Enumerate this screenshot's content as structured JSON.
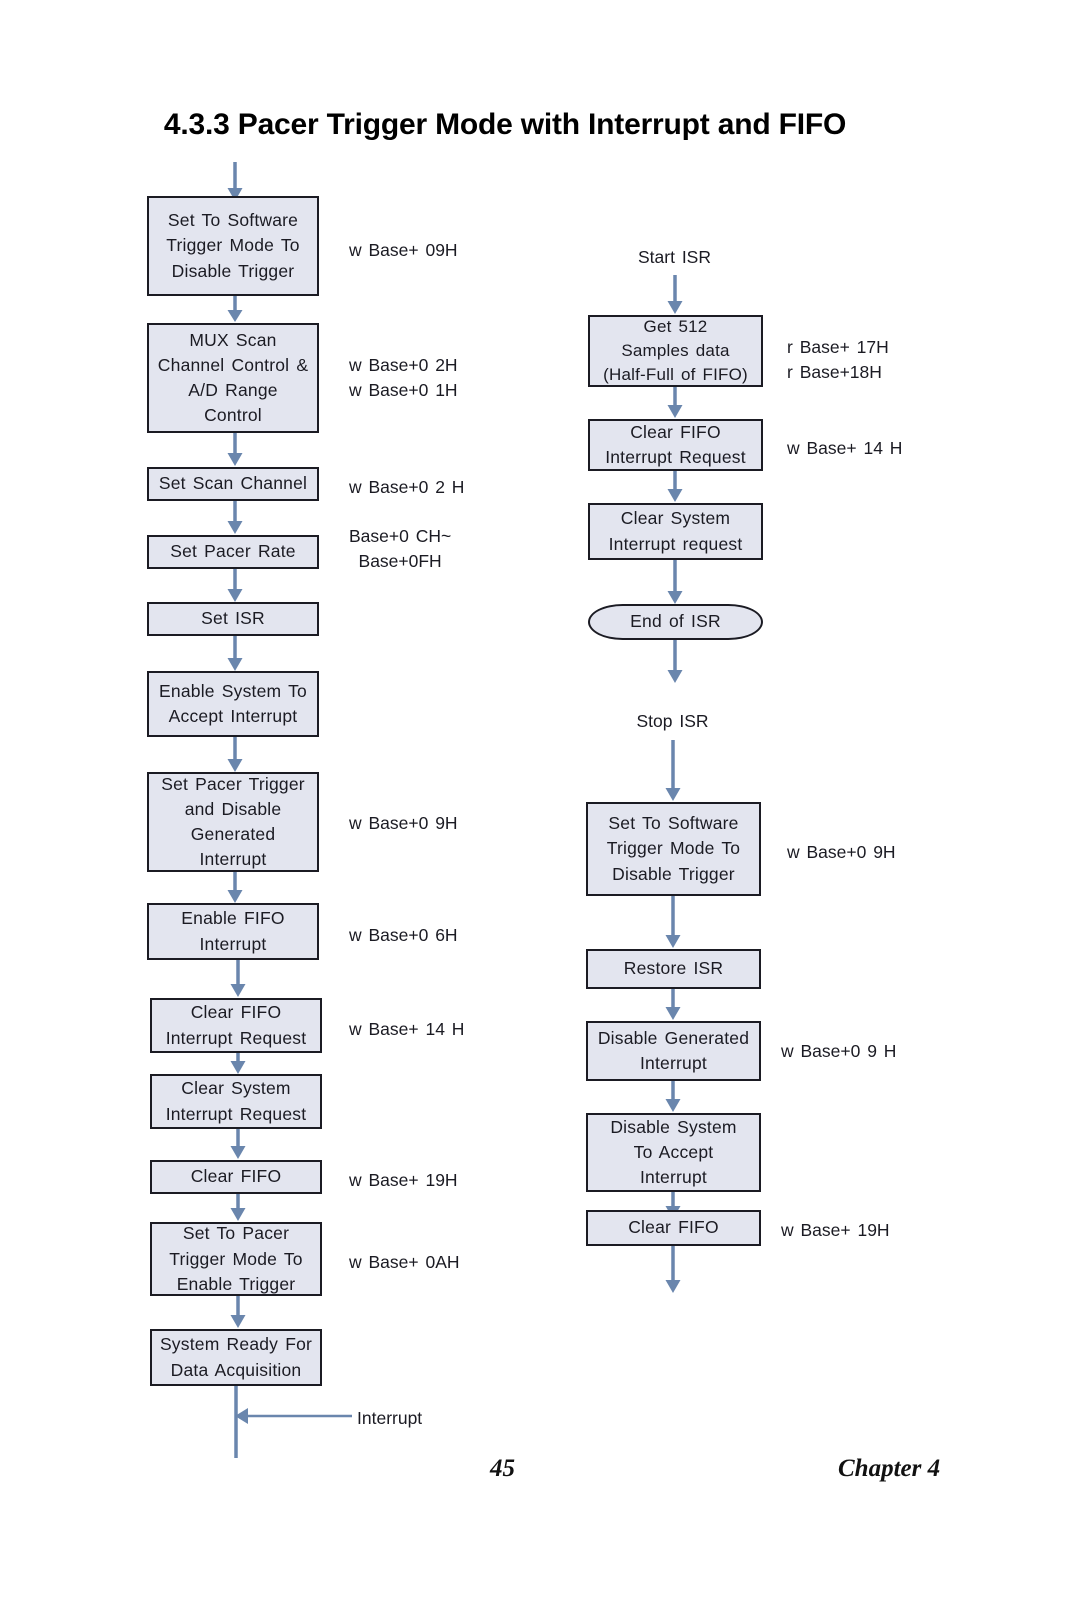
{
  "title": "4.3.3 Pacer Trigger Mode with Interrupt and FIFO",
  "colors": {
    "node_fill": "#e3e5ef",
    "node_border": "#1b1b23",
    "arrow": "#6a86ad",
    "text": "#1b1b23"
  },
  "left_flow": {
    "nodes": [
      {
        "id": "set-software-trigger-disable",
        "lines": [
          "Set To Software",
          "Trigger Mode To",
          "Disable Trigger"
        ],
        "note": [
          "w Base+ 09H"
        ]
      },
      {
        "id": "mux-scan-channel-control",
        "lines": [
          "MUX Scan",
          "Channel Control &",
          "A/D Range",
          "Control"
        ],
        "note": [
          "w Base+0 2H",
          "w Base+0 1H"
        ]
      },
      {
        "id": "set-scan-channel",
        "lines": [
          "Set Scan Channel"
        ],
        "note": [
          "w Base+0 2 H"
        ]
      },
      {
        "id": "set-pacer-rate",
        "lines": [
          "Set Pacer Rate"
        ],
        "note": [
          "Base+0 CH~",
          "Base+0FH"
        ]
      },
      {
        "id": "set-isr",
        "lines": [
          "Set ISR"
        ],
        "note": []
      },
      {
        "id": "enable-system-accept-interrupt",
        "lines": [
          "Enable System To",
          "Accept Interrupt"
        ],
        "note": []
      },
      {
        "id": "set-pacer-trigger-disable-generated-interrupt",
        "lines": [
          "Set Pacer Trigger",
          "and Disable",
          "Generated",
          "Interrupt"
        ],
        "note": [
          "w Base+0 9H"
        ]
      },
      {
        "id": "enable-fifo-interrupt",
        "lines": [
          "Enable FIFO",
          "Interrupt"
        ],
        "note": [
          "w Base+0 6H"
        ]
      },
      {
        "id": "clear-fifo-interrupt-request",
        "lines": [
          "Clear FIFO",
          "Interrupt Request"
        ],
        "note": [
          "w Base+ 14 H"
        ]
      },
      {
        "id": "clear-system-interrupt-request",
        "lines": [
          "Clear System",
          "Interrupt Request"
        ],
        "note": []
      },
      {
        "id": "clear-fifo",
        "lines": [
          "Clear FIFO"
        ],
        "note": [
          "w Base+ 19H"
        ]
      },
      {
        "id": "set-pacer-trigger-enable",
        "lines": [
          "Set To Pacer",
          "Trigger Mode To",
          "Enable Trigger"
        ],
        "note": [
          "w Base+ 0AH"
        ]
      },
      {
        "id": "system-ready-data-acquisition",
        "lines": [
          "System Ready For",
          "Data Acquisition"
        ],
        "note": []
      }
    ],
    "interrupt_label": "Interrupt"
  },
  "right_flow_isr": {
    "start_label": "Start ISR",
    "nodes": [
      {
        "id": "get-512-samples",
        "lines": [
          "Get 512",
          "Samples data",
          "(Half-Full of FIFO)"
        ],
        "note": [
          "r Base+ 17H",
          "r Base+18H"
        ]
      },
      {
        "id": "clear-fifo-interrupt-request-isr",
        "lines": [
          "Clear FIFO",
          "Interrupt Request"
        ],
        "note": [
          "w Base+ 14 H"
        ]
      },
      {
        "id": "clear-system-interrupt-request-isr",
        "lines": [
          "Clear System",
          "Interrupt request"
        ],
        "note": []
      },
      {
        "id": "end-of-isr",
        "lines": [
          "End of ISR"
        ],
        "note": [],
        "shape": "terminator"
      }
    ]
  },
  "right_flow_stop": {
    "start_label": "Stop ISR",
    "nodes": [
      {
        "id": "set-software-trigger-disable-stop",
        "lines": [
          "Set To Software",
          "Trigger Mode To",
          "Disable Trigger"
        ],
        "note": [
          "w Base+0 9H"
        ]
      },
      {
        "id": "restore-isr",
        "lines": [
          "Restore ISR"
        ],
        "note": []
      },
      {
        "id": "disable-generated-interrupt",
        "lines": [
          "Disable Generated",
          "Interrupt"
        ],
        "note": [
          "w Base+0 9 H"
        ]
      },
      {
        "id": "disable-system-accept-interrupt",
        "lines": [
          "Disable System",
          "To Accept",
          "Interrupt"
        ],
        "note": []
      },
      {
        "id": "clear-fifo-stop",
        "lines": [
          "Clear FIFO"
        ],
        "note": [
          "w Base+ 19H"
        ]
      }
    ]
  },
  "footer": {
    "page_number": "45",
    "chapter": "Chapter 4"
  }
}
